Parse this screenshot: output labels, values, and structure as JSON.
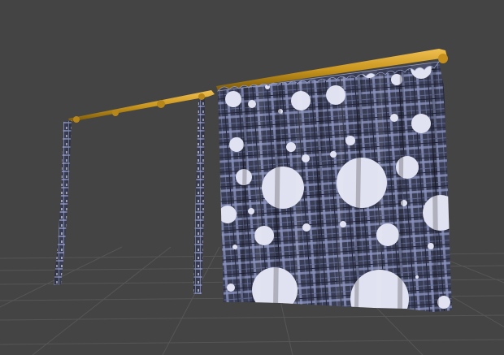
{
  "viewport": {
    "name": "3d-scene-viewport",
    "background_color": "#444444",
    "grid_line_color": "#565656"
  },
  "scene": {
    "objects": [
      {
        "name": "curtain-rod-left",
        "color": "#c9961e"
      },
      {
        "name": "curtain-rod-right",
        "color": "#c9961e"
      },
      {
        "name": "curtain-panel-left-outer"
      },
      {
        "name": "curtain-panel-left-inner"
      },
      {
        "name": "curtain-panel-main"
      }
    ],
    "fabric": {
      "pattern": "plaid-with-polka-dots",
      "base_color": "#3b3f56",
      "stripe_color": "#9aa3cc",
      "dot_color": "#e1e2f1"
    }
  }
}
